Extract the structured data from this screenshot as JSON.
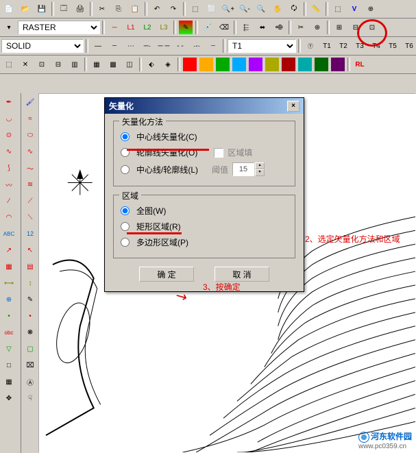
{
  "row2": {
    "layer_combo": "RASTER",
    "btns_layer": [
      "─",
      "L1",
      "L2",
      "L3"
    ]
  },
  "row3": {
    "linetype_combo": "SOLID",
    "text_combo": "T1",
    "tbtns": [
      "T1",
      "T2",
      "T3",
      "T4",
      "T5",
      "T6"
    ]
  },
  "row4": {
    "rl_btn": "RL"
  },
  "dialog": {
    "title": "矢量化",
    "close": "×",
    "group_method": {
      "legend": "矢量化方法",
      "opt_center": "中心线矢量化(C)",
      "opt_outline": "轮廓线矢量化(O)",
      "opt_both": "中心线/轮廓线(L)",
      "chk_fill_label": "区域填",
      "threshold_label": "阈值",
      "threshold_value": "15"
    },
    "group_region": {
      "legend": "区域",
      "opt_full": "全图(W)",
      "opt_rect": "矩形区域(R)",
      "opt_poly": "多边形区域(P)"
    },
    "ok": "确 定",
    "cancel": "取 消"
  },
  "annotations": {
    "a2": "2、选定矢量化方法和区域",
    "a3": "3、按确定"
  },
  "watermark": {
    "name": "河东软件园",
    "url": "www.pc0359.cn"
  }
}
